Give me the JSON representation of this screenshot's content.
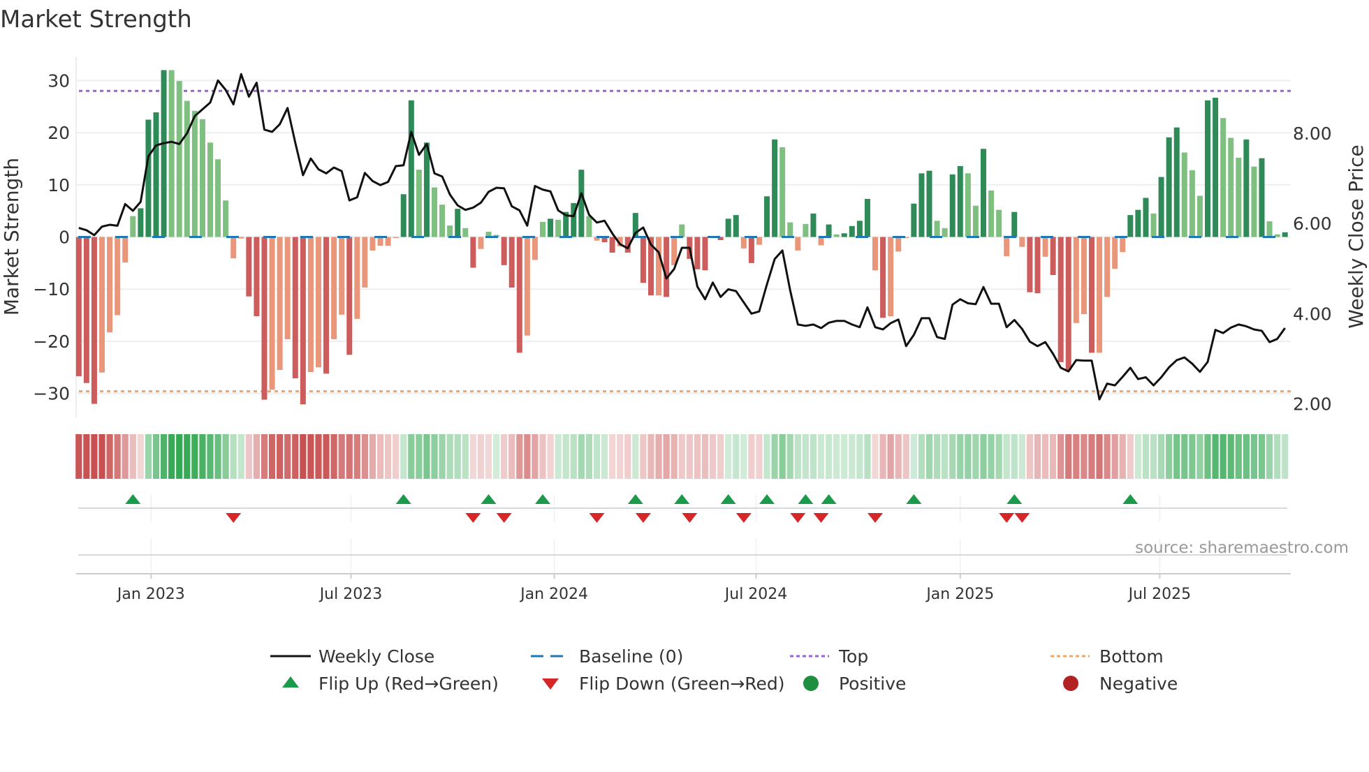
{
  "title": "Market Strength",
  "source": "source: sharemaestro.com",
  "colors": {
    "strong_up": "#2e8b57",
    "weak_up": "#7fbf7f",
    "strong_down": "#cd5c5c",
    "weak_down": "#e9967a",
    "line": "#111111",
    "baseline": "#1f77b4",
    "top": "#9b5fe0",
    "bottom": "#f4a460",
    "flip_up": "#1a9a4a",
    "flip_down": "#d62728",
    "positive": "#1e8f3e",
    "negative": "#b22222"
  },
  "legend": {
    "weekly_close": "Weekly Close",
    "baseline": "Baseline (0)",
    "top": "Top",
    "bottom": "Bottom",
    "flip_up": "Flip Up (Red→Green)",
    "flip_down": "Flip Down (Green→Red)",
    "positive": "Positive",
    "negative": "Negative"
  },
  "chart_data": {
    "type": "bar",
    "title": "Market Strength",
    "ylabel": "Market Strength",
    "y2label": "Weekly Close Price",
    "ylim": [
      -34.6,
      34.6
    ],
    "y2lim": [
      1.7,
      9.7
    ],
    "yticks": [
      30,
      20,
      10,
      0,
      -10,
      -20,
      -30
    ],
    "ytick_labels": [
      "30",
      "20",
      "10",
      "0",
      "−10",
      "−20",
      "−30"
    ],
    "y2ticks": [
      8,
      6,
      4,
      2
    ],
    "y2tick_labels": [
      "8.00",
      "6.00",
      "4.00",
      "2.00"
    ],
    "top_level": 28,
    "bottom_level": -29.6,
    "baseline": 0,
    "xticks": [
      {
        "label": "Jan 2023",
        "week": 10.35
      },
      {
        "label": "Jul 2023",
        "week": 36.2
      },
      {
        "label": "Jan 2024",
        "week": 62.5
      },
      {
        "label": "Jul 2024",
        "week": 88.6
      },
      {
        "label": "Jan 2025",
        "week": 115
      },
      {
        "label": "Jul 2025",
        "week": 140.8
      }
    ],
    "strength": [
      -26.7,
      -28,
      -32,
      -26,
      -18.3,
      -15,
      -4.9,
      4,
      5.5,
      22.5,
      23.9,
      32,
      32,
      29.9,
      26.1,
      24.2,
      22.6,
      18.1,
      14.9,
      7,
      -4.1,
      -0.3,
      -11.4,
      -15.2,
      -31.2,
      -29.3,
      -25.5,
      -19.6,
      -27.1,
      -32.1,
      -25.9,
      -25,
      -26.2,
      -19.6,
      -14.9,
      -22.6,
      -15.7,
      -9.7,
      -2.6,
      -1.7,
      -1.7,
      -0.2,
      8.2,
      26.2,
      12.9,
      18.1,
      9.5,
      6.2,
      2.2,
      5.4,
      1.7,
      -5.9,
      -2.3,
      1,
      0.4,
      -5.4,
      -9.7,
      -22.2,
      -18.9,
      -4.4,
      2.9,
      3.5,
      3.3,
      4.8,
      6.5,
      12.9,
      4,
      -0.7,
      -1,
      -3,
      -1.8,
      -3,
      4.6,
      -8.8,
      -11.2,
      -11.2,
      -11.5,
      -5.4,
      2.4,
      -4.2,
      -6.2,
      -6.4,
      -0.2,
      -0.6,
      3.5,
      4.2,
      -2.2,
      -5,
      -1.5,
      7.8,
      18.7,
      17.2,
      2.8,
      -2.6,
      2.5,
      4.5,
      -1.6,
      2.4,
      0.5,
      0.7,
      2.1,
      3.1,
      7.3,
      -6.4,
      -15.5,
      -15.2,
      -2.8,
      -0.2,
      6.4,
      12.2,
      12.7,
      3.1,
      1.7,
      12,
      13.6,
      12.2,
      6,
      16.9,
      8.9,
      5.2,
      -3.7,
      4.8,
      -1.9,
      -10.6,
      -10.8,
      -3.8,
      -7.3,
      -24,
      -25.5,
      -16.5,
      -14.8,
      -22.2,
      -22.2,
      -11.5,
      -6.1,
      -2.9,
      4.2,
      5.2,
      7.5,
      4.5,
      11.5,
      19.1,
      21,
      16.2,
      12.8,
      7.9,
      26.2,
      26.7,
      22.8,
      19,
      15.2,
      18.7,
      13.5,
      15.1,
      3,
      0.5,
      0.9
    ],
    "weekly_close": [
      5.9,
      5.85,
      5.74,
      5.93,
      5.97,
      5.95,
      6.43,
      6.28,
      6.48,
      7.49,
      7.73,
      7.78,
      7.81,
      7.76,
      8.0,
      8.38,
      8.53,
      8.68,
      9.17,
      8.96,
      8.64,
      9.31,
      8.81,
      9.12,
      8.08,
      8.03,
      8.2,
      8.56,
      7.79,
      7.07,
      7.44,
      7.2,
      7.11,
      7.24,
      7.16,
      6.51,
      6.58,
      7.12,
      6.94,
      6.85,
      6.92,
      7.27,
      7.29,
      8.03,
      7.52,
      7.76,
      7.11,
      7.04,
      6.64,
      6.4,
      6.3,
      6.35,
      6.46,
      6.7,
      6.79,
      6.78,
      6.38,
      6.29,
      5.95,
      6.83,
      6.75,
      6.71,
      6.29,
      6.18,
      6.16,
      6.67,
      6.19,
      6.02,
      6.06,
      5.78,
      5.54,
      5.45,
      5.79,
      5.91,
      5.53,
      5.36,
      4.78,
      4.99,
      5.46,
      5.46,
      4.6,
      4.32,
      4.69,
      4.37,
      4.54,
      4.5,
      4.25,
      4.0,
      4.05,
      4.65,
      5.21,
      5.4,
      4.52,
      3.76,
      3.73,
      3.76,
      3.68,
      3.8,
      3.84,
      3.84,
      3.76,
      3.7,
      4.14,
      3.7,
      3.65,
      3.79,
      3.87,
      3.28,
      3.53,
      3.9,
      3.9,
      3.48,
      3.44,
      4.2,
      4.32,
      4.23,
      4.21,
      4.59,
      4.22,
      4.22,
      3.7,
      3.86,
      3.66,
      3.38,
      3.28,
      3.37,
      3.11,
      2.8,
      2.72,
      2.97,
      2.96,
      2.96,
      2.1,
      2.45,
      2.41,
      2.6,
      2.8,
      2.55,
      2.59,
      2.41,
      2.59,
      2.81,
      2.97,
      3.03,
      2.89,
      2.71,
      2.93,
      3.64,
      3.57,
      3.69,
      3.76,
      3.72,
      3.65,
      3.62,
      3.37,
      3.44,
      3.68
    ],
    "flip_up_weeks": [
      8,
      43,
      54,
      61,
      73,
      79,
      85,
      90,
      95,
      98,
      109,
      122,
      137
    ],
    "flip_down_weeks": [
      21,
      52,
      56,
      68,
      74,
      80,
      87,
      94,
      97,
      104,
      121,
      123
    ],
    "grid": true,
    "legend_position": "bottom"
  }
}
